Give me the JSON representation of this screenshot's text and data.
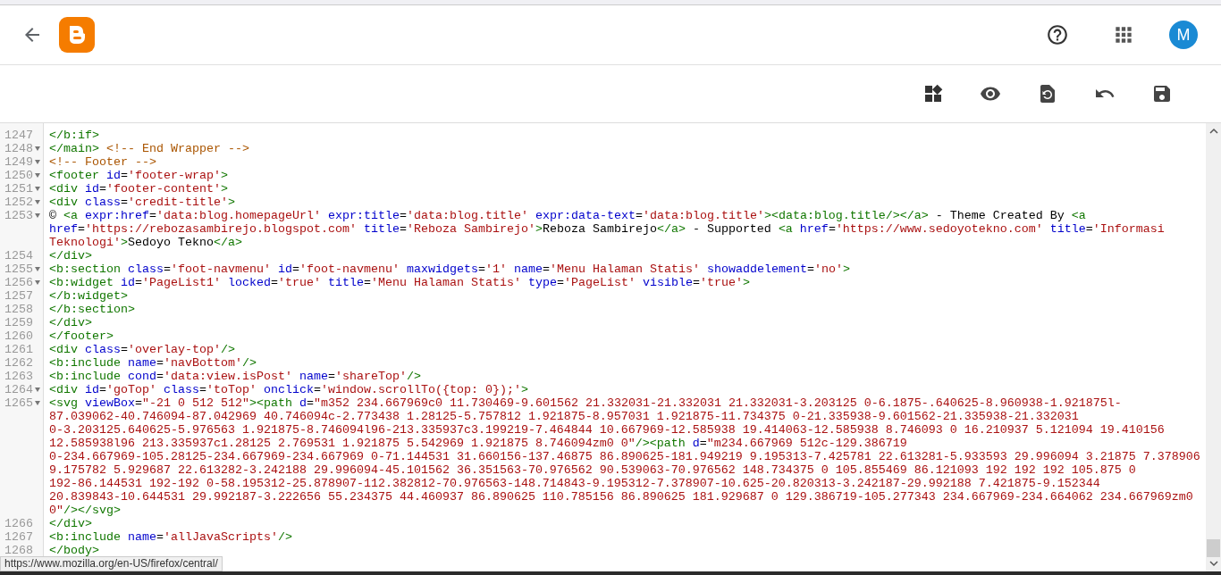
{
  "header": {
    "avatar": "M"
  },
  "editor": {
    "lines": [
      {
        "number": "1247",
        "foldable": false,
        "tokens": [
          {
            "kind": "tag",
            "text": "</b:if>"
          }
        ]
      },
      {
        "number": "1248",
        "foldable": true,
        "tokens": [
          {
            "kind": "tag",
            "text": "</main>"
          },
          {
            "kind": "comment",
            "text": " <!-- End Wrapper -->"
          }
        ]
      },
      {
        "number": "1249",
        "foldable": true,
        "tokens": [
          {
            "kind": "comment",
            "text": "<!-- Footer -->"
          }
        ]
      },
      {
        "number": "1250",
        "foldable": true,
        "tokens": [
          {
            "kind": "tag",
            "text": "<footer"
          },
          {
            "kind": "attr",
            "text": " id"
          },
          {
            "kind": "plain",
            "text": "="
          },
          {
            "kind": "value",
            "text": "'footer-wrap'"
          },
          {
            "kind": "tag",
            "text": ">"
          }
        ]
      },
      {
        "number": "1251",
        "foldable": true,
        "tokens": [
          {
            "kind": "tag",
            "text": "<div"
          },
          {
            "kind": "attr",
            "text": " id"
          },
          {
            "kind": "plain",
            "text": "="
          },
          {
            "kind": "value",
            "text": "'footer-content'"
          },
          {
            "kind": "tag",
            "text": ">"
          }
        ]
      },
      {
        "number": "1252",
        "foldable": true,
        "tokens": [
          {
            "kind": "tag",
            "text": "<div"
          },
          {
            "kind": "attr",
            "text": " class"
          },
          {
            "kind": "plain",
            "text": "="
          },
          {
            "kind": "value",
            "text": "'credit-title'"
          },
          {
            "kind": "tag",
            "text": ">"
          }
        ]
      },
      {
        "number": "1253",
        "foldable": true,
        "tokens": [
          {
            "kind": "plain",
            "text": "© "
          },
          {
            "kind": "tag",
            "text": "<a"
          },
          {
            "kind": "attr",
            "text": " expr:href"
          },
          {
            "kind": "plain",
            "text": "="
          },
          {
            "kind": "value",
            "text": "'data:blog.homepageUrl'"
          },
          {
            "kind": "attr",
            "text": " expr:title"
          },
          {
            "kind": "plain",
            "text": "="
          },
          {
            "kind": "value",
            "text": "'data:blog.title'"
          },
          {
            "kind": "attr",
            "text": " expr:data-text"
          },
          {
            "kind": "plain",
            "text": "="
          },
          {
            "kind": "value",
            "text": "'data:blog.title'"
          },
          {
            "kind": "tag",
            "text": "><data:blog.title/></a>"
          },
          {
            "kind": "plain",
            "text": " - Theme Created By "
          },
          {
            "kind": "tag",
            "text": "<a"
          },
          {
            "kind": "wrap"
          },
          {
            "kind": "attr",
            "text": "href"
          },
          {
            "kind": "plain",
            "text": "="
          },
          {
            "kind": "value",
            "text": "'https://rebozasambirejo.blogspot.com'"
          },
          {
            "kind": "attr",
            "text": " title"
          },
          {
            "kind": "plain",
            "text": "="
          },
          {
            "kind": "value",
            "text": "'Reboza Sambirejo'"
          },
          {
            "kind": "tag",
            "text": ">"
          },
          {
            "kind": "plain",
            "text": "Reboza Sambirejo"
          },
          {
            "kind": "tag",
            "text": "</a>"
          },
          {
            "kind": "plain",
            "text": " - Supported "
          },
          {
            "kind": "tag",
            "text": "<a"
          },
          {
            "kind": "attr",
            "text": " href"
          },
          {
            "kind": "plain",
            "text": "="
          },
          {
            "kind": "value",
            "text": "'https://www.sedoyotekno.com'"
          },
          {
            "kind": "attr",
            "text": " title"
          },
          {
            "kind": "plain",
            "text": "="
          },
          {
            "kind": "value",
            "text": "'Informasi"
          },
          {
            "kind": "wrap"
          },
          {
            "kind": "value",
            "text": "Teknologi'"
          },
          {
            "kind": "tag",
            "text": ">"
          },
          {
            "kind": "plain",
            "text": "Sedoyo Tekno"
          },
          {
            "kind": "tag",
            "text": "</a>"
          }
        ]
      },
      {
        "number": "1254",
        "foldable": false,
        "tokens": [
          {
            "kind": "tag",
            "text": "</div>"
          }
        ]
      },
      {
        "number": "1255",
        "foldable": true,
        "tokens": [
          {
            "kind": "tag",
            "text": "<b:section"
          },
          {
            "kind": "attr",
            "text": " class"
          },
          {
            "kind": "plain",
            "text": "="
          },
          {
            "kind": "value",
            "text": "'foot-navmenu'"
          },
          {
            "kind": "attr",
            "text": " id"
          },
          {
            "kind": "plain",
            "text": "="
          },
          {
            "kind": "value",
            "text": "'foot-navmenu'"
          },
          {
            "kind": "attr",
            "text": " maxwidgets"
          },
          {
            "kind": "plain",
            "text": "="
          },
          {
            "kind": "value",
            "text": "'1'"
          },
          {
            "kind": "attr",
            "text": " name"
          },
          {
            "kind": "plain",
            "text": "="
          },
          {
            "kind": "value",
            "text": "'Menu Halaman Statis'"
          },
          {
            "kind": "attr",
            "text": " showaddelement"
          },
          {
            "kind": "plain",
            "text": "="
          },
          {
            "kind": "value",
            "text": "'no'"
          },
          {
            "kind": "tag",
            "text": ">"
          }
        ]
      },
      {
        "number": "1256",
        "foldable": true,
        "tokens": [
          {
            "kind": "tag",
            "text": "<b:widget"
          },
          {
            "kind": "attr",
            "text": " id"
          },
          {
            "kind": "plain",
            "text": "="
          },
          {
            "kind": "value",
            "text": "'PageList1'"
          },
          {
            "kind": "attr",
            "text": " locked"
          },
          {
            "kind": "plain",
            "text": "="
          },
          {
            "kind": "value",
            "text": "'true'"
          },
          {
            "kind": "attr",
            "text": " title"
          },
          {
            "kind": "plain",
            "text": "="
          },
          {
            "kind": "value",
            "text": "'Menu Halaman Statis'"
          },
          {
            "kind": "attr",
            "text": " type"
          },
          {
            "kind": "plain",
            "text": "="
          },
          {
            "kind": "value",
            "text": "'PageList'"
          },
          {
            "kind": "attr",
            "text": " visible"
          },
          {
            "kind": "plain",
            "text": "="
          },
          {
            "kind": "value",
            "text": "'true'"
          },
          {
            "kind": "tag",
            "text": ">"
          }
        ]
      },
      {
        "number": "1257",
        "foldable": false,
        "tokens": [
          {
            "kind": "tag",
            "text": "</b:widget>"
          }
        ]
      },
      {
        "number": "1258",
        "foldable": false,
        "tokens": [
          {
            "kind": "tag",
            "text": "</b:section>"
          }
        ]
      },
      {
        "number": "1259",
        "foldable": false,
        "tokens": [
          {
            "kind": "tag",
            "text": "</div>"
          }
        ]
      },
      {
        "number": "1260",
        "foldable": false,
        "tokens": [
          {
            "kind": "tag",
            "text": "</footer>"
          }
        ]
      },
      {
        "number": "1261",
        "foldable": false,
        "tokens": [
          {
            "kind": "tag",
            "text": "<div"
          },
          {
            "kind": "attr",
            "text": " class"
          },
          {
            "kind": "plain",
            "text": "="
          },
          {
            "kind": "value",
            "text": "'overlay-top'"
          },
          {
            "kind": "tag",
            "text": "/>"
          }
        ]
      },
      {
        "number": "1262",
        "foldable": false,
        "tokens": [
          {
            "kind": "tag",
            "text": "<b:include"
          },
          {
            "kind": "attr",
            "text": " name"
          },
          {
            "kind": "plain",
            "text": "="
          },
          {
            "kind": "value",
            "text": "'navBottom'"
          },
          {
            "kind": "tag",
            "text": "/>"
          }
        ]
      },
      {
        "number": "1263",
        "foldable": false,
        "tokens": [
          {
            "kind": "tag",
            "text": "<b:include"
          },
          {
            "kind": "attr",
            "text": " cond"
          },
          {
            "kind": "plain",
            "text": "="
          },
          {
            "kind": "value",
            "text": "'data:view.isPost'"
          },
          {
            "kind": "attr",
            "text": " name"
          },
          {
            "kind": "plain",
            "text": "="
          },
          {
            "kind": "value",
            "text": "'shareTop'"
          },
          {
            "kind": "tag",
            "text": "/>"
          }
        ]
      },
      {
        "number": "1264",
        "foldable": true,
        "tokens": [
          {
            "kind": "tag",
            "text": "<div"
          },
          {
            "kind": "attr",
            "text": " id"
          },
          {
            "kind": "plain",
            "text": "="
          },
          {
            "kind": "value",
            "text": "'goTop'"
          },
          {
            "kind": "attr",
            "text": " class"
          },
          {
            "kind": "plain",
            "text": "="
          },
          {
            "kind": "value",
            "text": "'toTop'"
          },
          {
            "kind": "attr",
            "text": " onclick"
          },
          {
            "kind": "plain",
            "text": "="
          },
          {
            "kind": "value",
            "text": "'window.scrollTo({top: 0});'"
          },
          {
            "kind": "tag",
            "text": ">"
          }
        ]
      },
      {
        "number": "1265",
        "foldable": true,
        "tokens": [
          {
            "kind": "tag",
            "text": "<svg"
          },
          {
            "kind": "attr",
            "text": " viewBox"
          },
          {
            "kind": "plain",
            "text": "="
          },
          {
            "kind": "value",
            "text": "\"-21 0 512 512\""
          },
          {
            "kind": "tag",
            "text": "><path"
          },
          {
            "kind": "attr",
            "text": " d"
          },
          {
            "kind": "plain",
            "text": "="
          },
          {
            "kind": "value",
            "text": "\"m352 234.667969c0 11.730469-9.601562 21.332031-21.332031 21.332031-3.203125 0-6.1875-.640625-8.960938-1.921875l-"
          },
          {
            "kind": "wrap"
          },
          {
            "kind": "value",
            "text": "87.039062-40.746094-87.042969 40.746094c-2.773438 1.28125-5.757812 1.921875-8.957031 1.921875-11.734375 0-21.335938-9.601562-21.335938-21.332031"
          },
          {
            "kind": "wrap"
          },
          {
            "kind": "value",
            "text": "0-3.203125.640625-5.976563 1.921875-8.746094l96-213.335937c3.199219-7.464844 10.667969-12.585938 19.414063-12.585938 8.746093 0 16.210937 5.121094 19.410156"
          },
          {
            "kind": "wrap"
          },
          {
            "kind": "value",
            "text": "12.585938l96 213.335937c1.28125 2.769531 1.921875 5.542969 1.921875 8.746094zm0 0\""
          },
          {
            "kind": "tag",
            "text": "/><path"
          },
          {
            "kind": "attr",
            "text": " d"
          },
          {
            "kind": "plain",
            "text": "="
          },
          {
            "kind": "value",
            "text": "\"m234.667969 512c-129.386719"
          },
          {
            "kind": "wrap"
          },
          {
            "kind": "value",
            "text": "0-234.667969-105.28125-234.667969-234.667969 0-71.144531 31.660156-137.46875 86.890625-181.949219 9.195313-7.425781 22.613281-5.933593 29.996094 3.21875 7.378906"
          },
          {
            "kind": "wrap"
          },
          {
            "kind": "value",
            "text": "9.175782 5.929687 22.613282-3.242188 29.996094-45.101562 36.351563-70.976562 90.539063-70.976562 148.734375 0 105.855469 86.121093 192 192 192 105.875 0"
          },
          {
            "kind": "wrap"
          },
          {
            "kind": "value",
            "text": "192-86.144531 192-192 0-58.195312-25.878907-112.382812-70.976563-148.714843-9.195312-7.378907-10.625-20.820313-3.242187-29.992188 7.421875-9.152344"
          },
          {
            "kind": "wrap"
          },
          {
            "kind": "value",
            "text": "20.839843-10.644531 29.992187-3.222656 55.234375 44.460937 86.890625 110.785156 86.890625 181.929687 0 129.386719-105.277343 234.667969-234.664062 234.667969zm0"
          },
          {
            "kind": "wrap"
          },
          {
            "kind": "value",
            "text": "0\""
          },
          {
            "kind": "tag",
            "text": "/></svg>"
          }
        ]
      },
      {
        "number": "1266",
        "foldable": false,
        "tokens": [
          {
            "kind": "tag",
            "text": "</div>"
          }
        ]
      },
      {
        "number": "1267",
        "foldable": false,
        "tokens": [
          {
            "kind": "tag",
            "text": "<b:include"
          },
          {
            "kind": "attr",
            "text": " name"
          },
          {
            "kind": "plain",
            "text": "="
          },
          {
            "kind": "value",
            "text": "'allJavaScripts'"
          },
          {
            "kind": "tag",
            "text": "/>"
          }
        ]
      },
      {
        "number": "1268",
        "foldable": false,
        "tokens": [
          {
            "kind": "tag",
            "text": "</body>"
          }
        ]
      }
    ]
  },
  "status_url": "https://www.mozilla.org/en-US/firefox/central/"
}
